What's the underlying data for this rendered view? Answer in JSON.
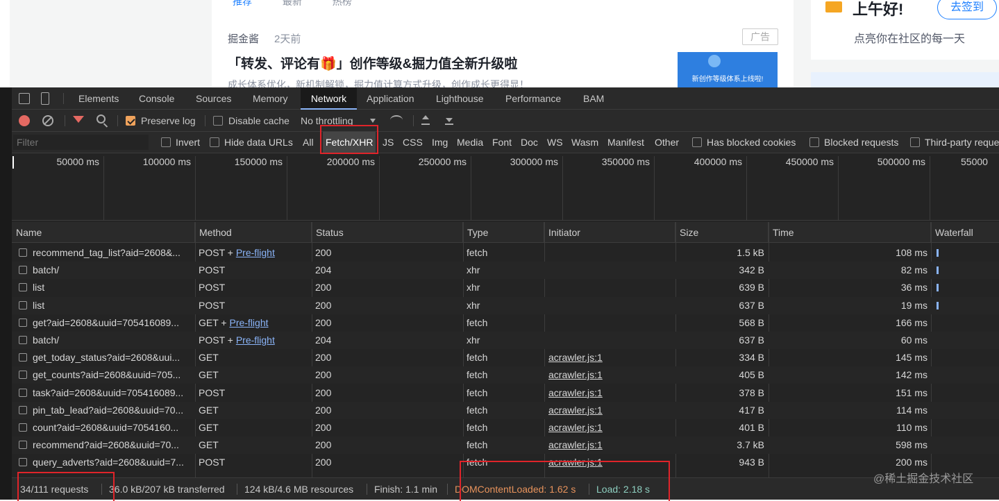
{
  "webpage": {
    "feed_tabs": [
      "推荐",
      "最新",
      "热榜"
    ],
    "author": "掘金酱",
    "time_ago": "2天前",
    "ad_tag": "广告",
    "article_title": "「转发、评论有🎁」创作等级&掘力值全新升级啦",
    "article_desc": "成长体系优化，新机制解锁，掘力值计算方式升级，创作成长更得显！",
    "thumb_text": "新创作等级体系上线啦!",
    "greeting": "上午好!",
    "checkin_button": "去签到",
    "greeting_sub": "点亮你在社区的每一天"
  },
  "devtools": {
    "panels": [
      "Elements",
      "Console",
      "Sources",
      "Memory",
      "Network",
      "Application",
      "Lighthouse",
      "Performance",
      "BAM"
    ],
    "active_panel": "Network",
    "toolbar": {
      "preserve_log": "Preserve log",
      "preserve_log_checked": true,
      "disable_cache": "Disable cache",
      "disable_cache_checked": false,
      "throttling": "No throttling"
    },
    "filterbar": {
      "placeholder": "Filter",
      "invert": "Invert",
      "hide_data_urls": "Hide data URLs",
      "types": [
        "All",
        "Fetch/XHR",
        "JS",
        "CSS",
        "Img",
        "Media",
        "Font",
        "Doc",
        "WS",
        "Wasm",
        "Manifest",
        "Other"
      ],
      "active_type": "Fetch/XHR",
      "has_blocked_cookies": "Has blocked cookies",
      "blocked_requests": "Blocked requests",
      "third_party": "Third-party reque"
    },
    "overview_ticks": [
      "50000 ms",
      "100000 ms",
      "150000 ms",
      "200000 ms",
      "250000 ms",
      "300000 ms",
      "350000 ms",
      "400000 ms",
      "450000 ms",
      "500000 ms",
      "55000"
    ],
    "columns": [
      "Name",
      "Method",
      "Status",
      "Type",
      "Initiator",
      "Size",
      "Time",
      "Waterfall"
    ],
    "rows": [
      {
        "name": "recommend_tag_list?aid=2608&...",
        "method": "POST + ",
        "preflight": "Pre-flight",
        "status": "200",
        "type": "fetch",
        "initiator": "",
        "size": "1.5 kB",
        "time": "108 ms",
        "wf": true
      },
      {
        "name": "batch/",
        "method": "POST",
        "preflight": "",
        "status": "204",
        "type": "xhr",
        "initiator": "",
        "size": "342 B",
        "time": "82 ms",
        "wf": true
      },
      {
        "name": "list",
        "method": "POST",
        "preflight": "",
        "status": "200",
        "type": "xhr",
        "initiator": "",
        "size": "639 B",
        "time": "36 ms",
        "wf": true
      },
      {
        "name": "list",
        "method": "POST",
        "preflight": "",
        "status": "200",
        "type": "xhr",
        "initiator": "",
        "size": "637 B",
        "time": "19 ms",
        "wf": true
      },
      {
        "name": "get?aid=2608&uuid=705416089...",
        "method": "GET + ",
        "preflight": "Pre-flight",
        "status": "200",
        "type": "fetch",
        "initiator": "",
        "size": "568 B",
        "time": "166 ms",
        "wf": false
      },
      {
        "name": "batch/",
        "method": "POST + ",
        "preflight": "Pre-flight",
        "status": "204",
        "type": "xhr",
        "initiator": "",
        "size": "637 B",
        "time": "60 ms",
        "wf": false
      },
      {
        "name": "get_today_status?aid=2608&uui...",
        "method": "GET",
        "preflight": "",
        "status": "200",
        "type": "fetch",
        "initiator": "acrawler.js:1",
        "size": "334 B",
        "time": "145 ms",
        "wf": false
      },
      {
        "name": "get_counts?aid=2608&uuid=705...",
        "method": "GET",
        "preflight": "",
        "status": "200",
        "type": "fetch",
        "initiator": "acrawler.js:1",
        "size": "405 B",
        "time": "142 ms",
        "wf": false
      },
      {
        "name": "task?aid=2608&uuid=705416089...",
        "method": "POST",
        "preflight": "",
        "status": "200",
        "type": "fetch",
        "initiator": "acrawler.js:1",
        "size": "378 B",
        "time": "151 ms",
        "wf": false
      },
      {
        "name": "pin_tab_lead?aid=2608&uuid=70...",
        "method": "GET",
        "preflight": "",
        "status": "200",
        "type": "fetch",
        "initiator": "acrawler.js:1",
        "size": "417 B",
        "time": "114 ms",
        "wf": false
      },
      {
        "name": "count?aid=2608&uuid=7054160...",
        "method": "GET",
        "preflight": "",
        "status": "200",
        "type": "fetch",
        "initiator": "acrawler.js:1",
        "size": "401 B",
        "time": "110 ms",
        "wf": false
      },
      {
        "name": "recommend?aid=2608&uuid=70...",
        "method": "GET",
        "preflight": "",
        "status": "200",
        "type": "fetch",
        "initiator": "acrawler.js:1",
        "size": "3.7 kB",
        "time": "598 ms",
        "wf": false
      },
      {
        "name": "query_adverts?aid=2608&uuid=7...",
        "method": "POST",
        "preflight": "",
        "status": "200",
        "type": "fetch",
        "initiator": "acrawler.js:1",
        "size": "943 B",
        "time": "200 ms",
        "wf": false
      }
    ],
    "status": {
      "requests": "34/111 requests",
      "transferred": "36.0 kB/207 kB transferred",
      "resources": "124 kB/4.6 MB resources",
      "finish": "Finish: 1.1 min",
      "dom_content_loaded": "DOMContentLoaded: 1.62 s",
      "load": "Load: 2.18 s"
    },
    "colors": {
      "dom_content_loaded": "#e8935c",
      "load": "#8ecfc0",
      "highlight": "#e0242a"
    }
  },
  "watermark": "@稀土掘金技术社区"
}
